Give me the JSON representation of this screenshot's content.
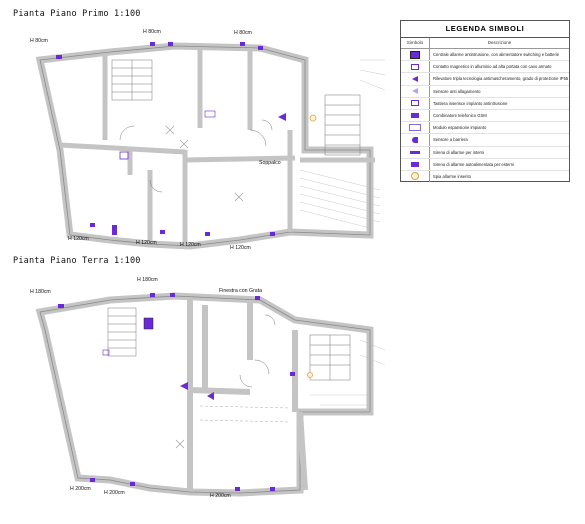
{
  "titles": {
    "first_floor": "Pianta Piano Primo 1:100",
    "ground_floor": "Pianta Piano Terra 1:100"
  },
  "legend": {
    "title": "LEGENDA SIMBOLI",
    "col_symbol": "Simbolo",
    "col_description": "Descrizione",
    "items": [
      {
        "icon": "control-panel-icon",
        "description": "Centrale allarme antintrusione, con alimentatore switching e batterie"
      },
      {
        "icon": "magnetic-contact-icon",
        "description": "Contatto magnetico in alluminio ad alta portata con cavo armato"
      },
      {
        "icon": "triple-sensor-icon",
        "description": "Rilevatore tripla tecnologia antimascheramento, grado di protezione IP55"
      },
      {
        "icon": "anti-flood-sensor-icon",
        "description": "Sensore anti allagamento"
      },
      {
        "icon": "keypad-icon",
        "description": "Tastiera inserisce impianto antintrusione"
      },
      {
        "icon": "gsm-dialer-icon",
        "description": "Combinatore telefonico GSM"
      },
      {
        "icon": "expansion-module-icon",
        "description": "Modulo espansione impianto"
      },
      {
        "icon": "barrier-sensor-icon",
        "description": "Sensore a barriera"
      },
      {
        "icon": "indoor-siren-icon",
        "description": "Sirena di allarme per interni"
      },
      {
        "icon": "outdoor-siren-icon",
        "description": "Sirena di allarme autoalimentata per esterni"
      },
      {
        "icon": "status-lamp-icon",
        "description": "Spia allarme inserito"
      }
    ]
  },
  "labels": {
    "first_floor": {
      "h80_left": "H 80cm",
      "h80_mid": "H 80cm",
      "h80_right": "H 80cm",
      "h120_a": "H 120cm",
      "h120_b": "H 120cm",
      "h120_c": "H 120cm",
      "h120_d": "H 120cm",
      "soppalco": "Soppalco"
    },
    "ground_floor": {
      "h180_left": "H 180cm",
      "h180_mid": "H 180cm",
      "finestra": "Finestra con Grata",
      "h200_a": "H 200cm",
      "h200_b": "H 200cm",
      "h200_c": "H 200cm"
    }
  },
  "colors": {
    "wall": "#c9c9c9",
    "wall_edge": "#8a8a8a",
    "device": "#6a2bd6",
    "accent_yellow": "#d5a14b"
  }
}
